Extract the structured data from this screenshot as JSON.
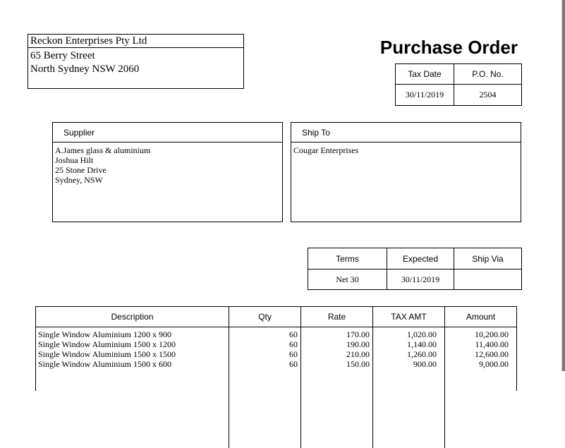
{
  "company": {
    "name": "Reckon Enterprises Pty Ltd",
    "address_line1": "65 Berry Street",
    "address_line2": "North Sydney NSW 2060"
  },
  "document_title": "Purchase Order",
  "order_info": {
    "tax_date_label": "Tax Date",
    "po_no_label": "P.O. No.",
    "tax_date": "30/11/2019",
    "po_no": "2504"
  },
  "supplier": {
    "label": "Supplier",
    "lines": [
      "A.James glass & aluminium",
      "Joshua Hilt",
      "25 Stone Drive",
      "Sydney, NSW"
    ]
  },
  "ship_to": {
    "label": "Ship To",
    "lines": [
      "Cougar Enterprises"
    ]
  },
  "terms_table": {
    "terms_label": "Terms",
    "expected_label": "Expected",
    "ship_via_label": "Ship Via",
    "terms": "Net 30",
    "expected": "30/11/2019",
    "ship_via": ""
  },
  "items": {
    "headers": [
      "Description",
      "Qty",
      "Rate",
      "TAX AMT",
      "Amount"
    ],
    "rows": [
      {
        "description": "Single Window Aluminium 1200 x 900",
        "qty": "60",
        "rate": "170.00",
        "tax_amt": "1,020.00",
        "amount": "10,200.00"
      },
      {
        "description": "Single Window Aluminium 1500 x 1200",
        "qty": "60",
        "rate": "190.00",
        "tax_amt": "1,140.00",
        "amount": "11,400.00"
      },
      {
        "description": "Single Window Aluminium 1500 x 1500",
        "qty": "60",
        "rate": "210.00",
        "tax_amt": "1,260.00",
        "amount": "12,600.00"
      },
      {
        "description": "Single Window Aluminium 1500 x 600",
        "qty": "60",
        "rate": "150.00",
        "tax_amt": "900.00",
        "amount": "9,000.00"
      }
    ]
  }
}
